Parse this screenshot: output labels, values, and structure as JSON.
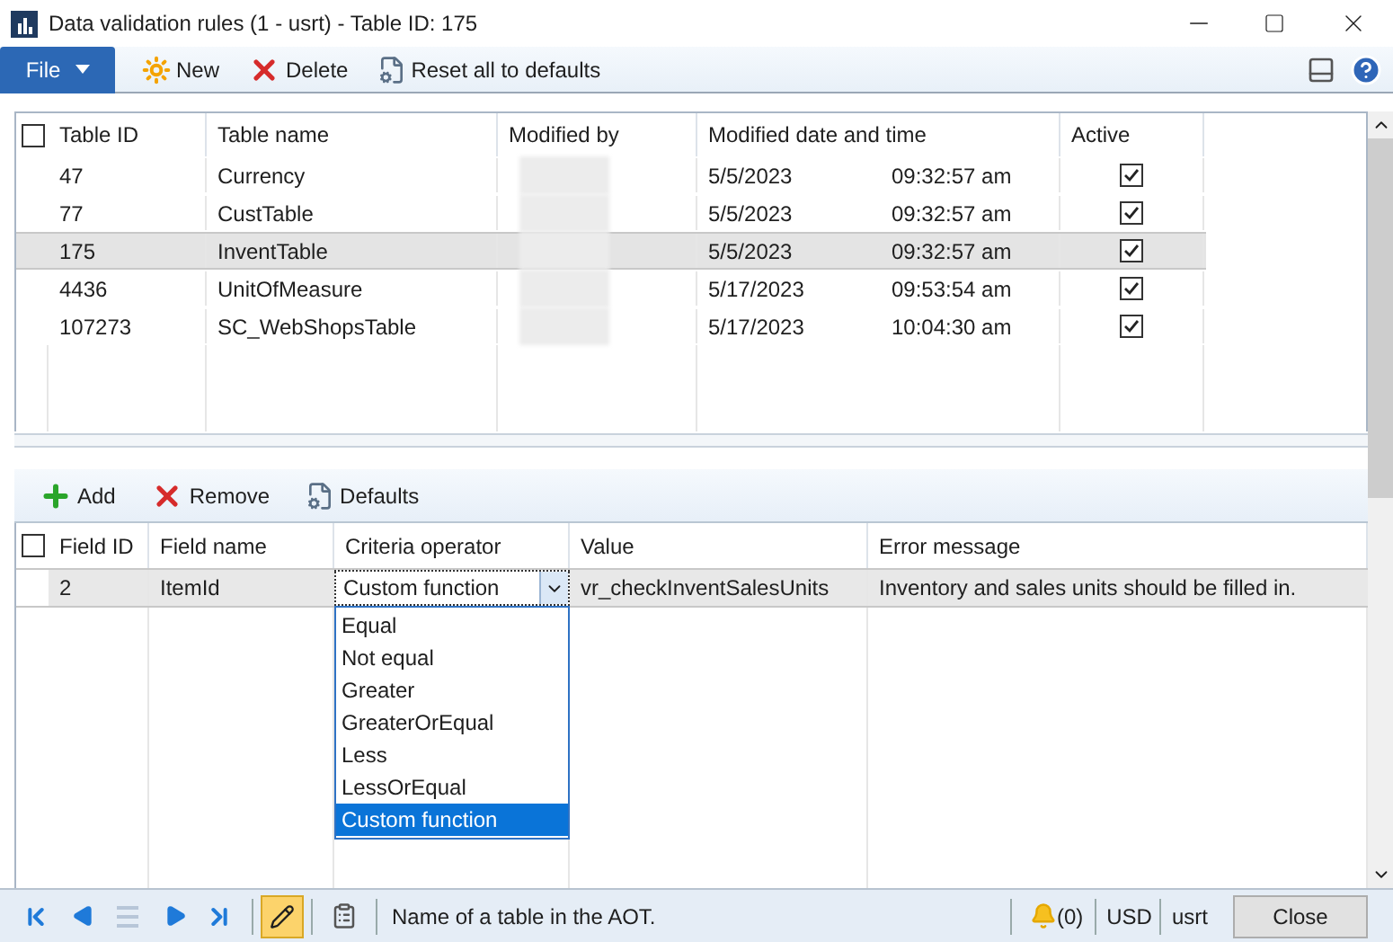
{
  "window": {
    "title": "Data validation rules (1 - usrt) - Table ID: 175"
  },
  "toolbar": {
    "file_menu": "File",
    "buttons": [
      {
        "label": "New",
        "kind": "new"
      },
      {
        "label": "Delete",
        "kind": "delete"
      },
      {
        "label": "Reset all to defaults",
        "kind": "reset"
      }
    ]
  },
  "tables_grid": {
    "header_checked": false,
    "columns": [
      "Table ID",
      "Table name",
      "Modified by",
      "Modified date and time",
      "Active"
    ],
    "rows": [
      {
        "table_id": "47",
        "table_name": "Currency",
        "date": "5/5/2023",
        "time": "09:32:57 am",
        "active": true,
        "selected": false
      },
      {
        "table_id": "77",
        "table_name": "CustTable",
        "date": "5/5/2023",
        "time": "09:32:57 am",
        "active": true,
        "selected": false
      },
      {
        "table_id": "175",
        "table_name": "InventTable",
        "date": "5/5/2023",
        "time": "09:32:57 am",
        "active": true,
        "selected": true
      },
      {
        "table_id": "4436",
        "table_name": "UnitOfMeasure",
        "date": "5/17/2023",
        "time": "09:53:54 am",
        "active": true,
        "selected": false
      },
      {
        "table_id": "107273",
        "table_name": "SC_WebShopsTable",
        "date": "5/17/2023",
        "time": "10:04:30 am",
        "active": true,
        "selected": false
      }
    ]
  },
  "fields_toolbar": {
    "buttons": [
      {
        "label": "Add",
        "kind": "add"
      },
      {
        "label": "Remove",
        "kind": "remove"
      },
      {
        "label": "Defaults",
        "kind": "defaults"
      }
    ]
  },
  "fields_grid": {
    "header_checked": false,
    "columns": [
      "Field ID",
      "Field name",
      "Criteria operator",
      "Value",
      "Error message"
    ],
    "rows": [
      {
        "field_id": "2",
        "field_name": "ItemId",
        "criteria_operator": "Custom function",
        "value": "vr_checkInventSalesUnits",
        "error_message": "Inventory and sales units should be filled in.",
        "selected": true
      }
    ],
    "operator_options": [
      {
        "label": "Equal",
        "selected": false
      },
      {
        "label": "Not equal",
        "selected": false
      },
      {
        "label": "Greater",
        "selected": false
      },
      {
        "label": "GreaterOrEqual",
        "selected": false
      },
      {
        "label": "Less",
        "selected": false
      },
      {
        "label": "LessOrEqual",
        "selected": false
      },
      {
        "label": "Custom function",
        "selected": true
      }
    ]
  },
  "status_bar": {
    "help_text": "Name of a table in the AOT.",
    "notifications": "(0)",
    "currency": "USD",
    "company": "usrt",
    "close_button": "Close"
  }
}
